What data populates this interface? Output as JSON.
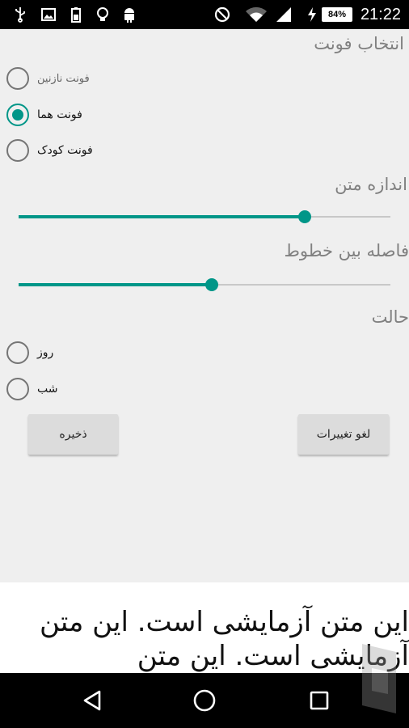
{
  "status_bar": {
    "time": "21:22",
    "battery": "84%",
    "icons": [
      "usb-icon",
      "image-icon",
      "battery-saver-icon",
      "lightbulb-icon",
      "android-icon",
      "do-not-disturb-icon",
      "wifi-icon",
      "signal-icon",
      "charging-icon",
      "battery-icon"
    ]
  },
  "font_section": {
    "title": "انتخاب فونت",
    "options": [
      {
        "label": "فونت نازنین",
        "checked": false
      },
      {
        "label": "فونت هما",
        "checked": true
      },
      {
        "label": "فونت کودک",
        "checked": false
      }
    ]
  },
  "size_section": {
    "title": "اندازه متن",
    "value": 0.77
  },
  "spacing_section": {
    "title": "فاصله بین خطوط",
    "value": 0.52
  },
  "mode_section": {
    "title": "حالت",
    "options": [
      {
        "label": "روز",
        "checked": false
      },
      {
        "label": "شب",
        "checked": false
      }
    ]
  },
  "buttons": {
    "save": "ذخیره",
    "cancel": "لغو تغییرات"
  },
  "preview": {
    "text": "این متن آزمایشی است. این متن آزمایشی است. این متن"
  },
  "colors": {
    "accent": "#009688",
    "background": "#efefef",
    "preview_background": "#ffffff"
  }
}
